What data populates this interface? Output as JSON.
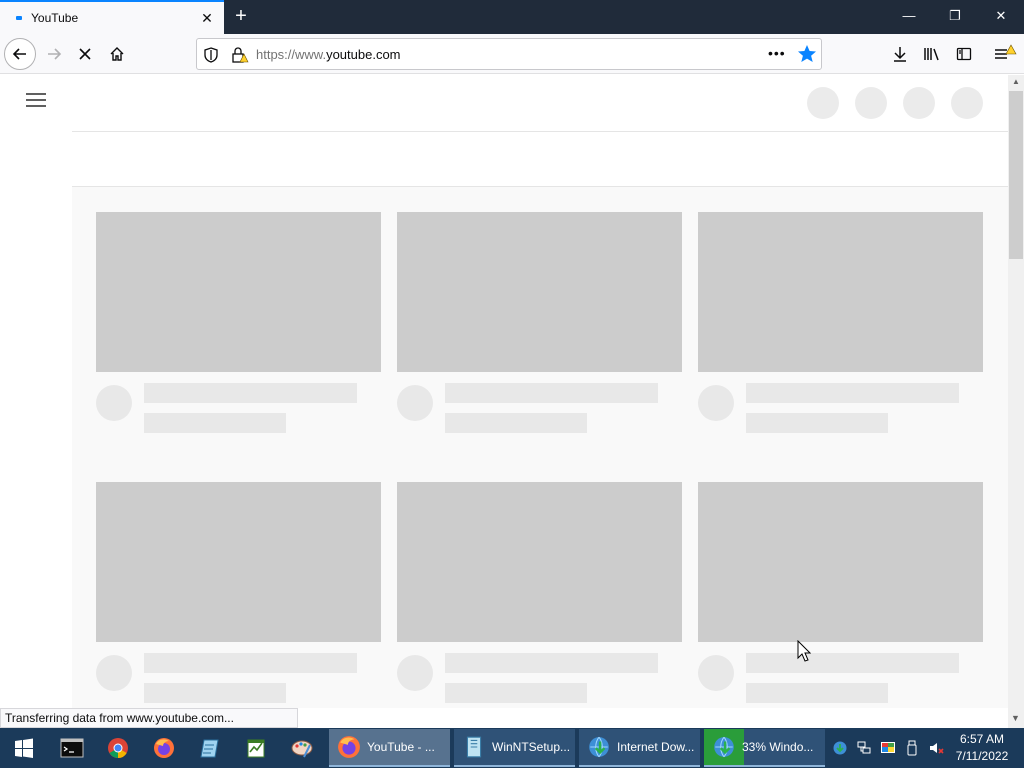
{
  "browser": {
    "tab": {
      "title": "YouTube",
      "favicon": "youtube-favicon"
    },
    "new_tab_icon": "plus-icon",
    "window_controls": [
      "minimize-icon",
      "restore-icon",
      "close-icon"
    ],
    "url": {
      "prefix": "https://www.",
      "host": "youtube.com"
    },
    "status_text": "Transferring data from www.youtube.com..."
  },
  "page": {
    "app": "YouTube",
    "loading_skeleton": {
      "rows": 2,
      "columns": 3
    }
  },
  "taskbar": {
    "pinned": [
      "command-prompt-icon",
      "chrome-icon",
      "firefox-icon",
      "notepad-icon",
      "editor-icon",
      "paint-icon"
    ],
    "tasks": [
      {
        "label": "YouTube - ...",
        "icon": "firefox-icon"
      },
      {
        "label": "WinNTSetup...",
        "icon": "setup-icon"
      },
      {
        "label": "Internet Dow...",
        "icon": "idm-icon"
      },
      {
        "label": "33% Windo...",
        "icon": "idm-icon",
        "progress": 0.33
      }
    ],
    "tray": [
      "idm-tray-icon",
      "network-icon",
      "display-icon",
      "usb-icon",
      "volume-muted-icon"
    ],
    "clock": {
      "time": "6:57 AM",
      "date": "7/11/2022"
    }
  },
  "colors": {
    "accent": "#0a84ff",
    "titlebar": "#202b3a",
    "taskbar": "#1b3a5a",
    "skeleton_thumb": "#cccccc",
    "skeleton_text": "#e8e8e8",
    "progress": "#2a9d3a"
  }
}
